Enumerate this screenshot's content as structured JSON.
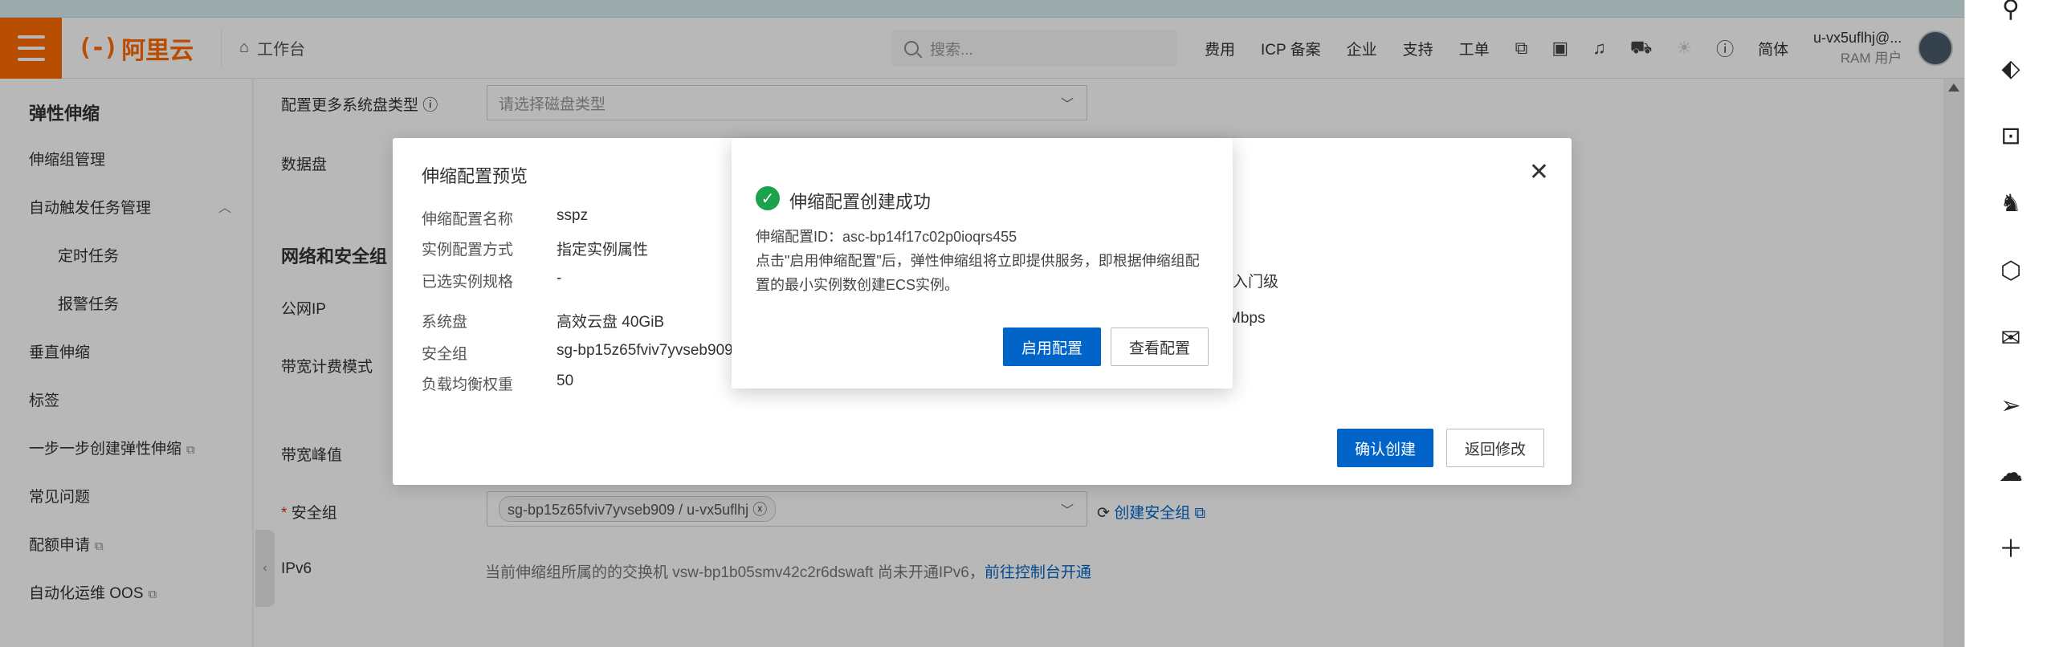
{
  "header": {
    "logo_mark": "(-)",
    "logo_text": "阿里云",
    "workbench_label": "工作台",
    "search_placeholder": "搜索...",
    "nav_items": [
      "费用",
      "ICP 备案",
      "企业",
      "支持",
      "工单"
    ],
    "language_label": "简体",
    "username": "u-vx5uflhj@...",
    "user_role": "RAM 用户",
    "brand_color": "#ff6a00"
  },
  "sidebar": {
    "title": "弹性伸缩",
    "items": [
      {
        "label": "伸缩组管理"
      },
      {
        "label": "自动触发任务管理"
      },
      {
        "label": "定时任务"
      },
      {
        "label": "报警任务"
      },
      {
        "label": "垂直伸缩"
      },
      {
        "label": "标签"
      },
      {
        "label": "一步一步创建弹性伸缩"
      },
      {
        "label": "常见问题"
      },
      {
        "label": "配额申请"
      },
      {
        "label": "自动化运维 OOS"
      }
    ]
  },
  "form": {
    "more_disk_label": "配置更多系统盘类型",
    "disk_type_placeholder": "请选择磁盘类型",
    "data_disk_label": "数据盘",
    "network_section": "网络和安全组",
    "public_ip_label": "公网IP",
    "bandwidth_billing_label": "带宽计费模式",
    "bandwidth_peak_label": "带宽峰值",
    "security_group_label": "安全组",
    "security_group_value": "sg-bp15z65fviv7yvseb909 / u-vx5uflhj",
    "create_sg_link": "创建安全组",
    "ipv6_label": "IPv6",
    "ipv6_text": "当前伸缩组所属的的交换机 vsw-bp1b05smv42c2r6dswaft 尚未开通IPv6，",
    "ipv6_link": "前往控制台开通"
  },
  "preview": {
    "title": "伸缩配置预览",
    "rows": [
      {
        "label": "伸缩配置名称",
        "value": "sspz"
      },
      {
        "label": "实例配置方式",
        "value": "指定实例属性"
      },
      {
        "label": "已选实例规格",
        "value": "-"
      },
      {
        "label": "系统盘",
        "value": "高效云盘 40GiB"
      },
      {
        "label": "安全组",
        "value": "sg-bp15z65fviv7yvseb909"
      },
      {
        "label": "负载均衡权重",
        "value": "50"
      }
    ],
    "right_values": [
      "入门级",
      "Mbps"
    ],
    "confirm_label": "确认创建",
    "back_label": "返回修改"
  },
  "success": {
    "title": "伸缩配置创建成功",
    "config_id_line": "伸缩配置ID：asc-bp14f17c02p0ioqrs455",
    "desc_line1": "点击\"启用伸缩配置\"后，弹性伸缩组将立即提供服务，即根据伸缩组配",
    "desc_line2": "置的最小实例数创建ECS实例。",
    "enable_label": "启用配置",
    "view_label": "查看配置",
    "success_color": "#1aa34a",
    "primary_color": "#0064c8"
  },
  "rail": {
    "icons": [
      "search-icon",
      "tag-icon",
      "toolbox-icon",
      "chess-icon",
      "cube-icon",
      "outlook-icon",
      "send-icon",
      "cloud-icon",
      "plus-icon"
    ]
  }
}
